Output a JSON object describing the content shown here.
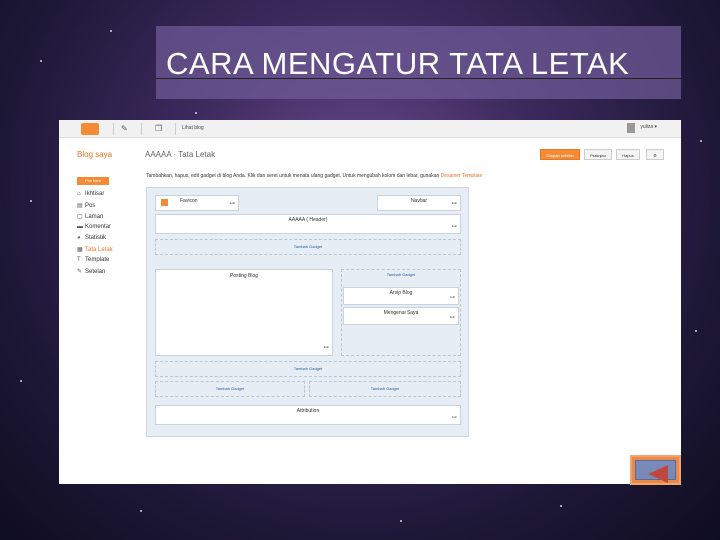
{
  "slide": {
    "title": "CARA MENGATUR TATA LETAK"
  },
  "blogger": {
    "toolbar": {
      "view_blog": "Lihat blog",
      "user": "yuliza ▾"
    },
    "blog_title": "Blog saya",
    "breadcrumb": "AAAAA · Tata Letak",
    "buttons": {
      "save": "Simpan setelan",
      "preview": "Pratinjau",
      "clear": "Hapus"
    },
    "sidebar": {
      "header": "Pos baru",
      "items": [
        {
          "icon": "⌂",
          "label": "Ikhtisar"
        },
        {
          "icon": "▤",
          "label": "Pos"
        },
        {
          "icon": "▢",
          "label": "Laman"
        },
        {
          "icon": "▬",
          "label": "Komentar"
        },
        {
          "icon": "◕",
          "label": "Statistik"
        },
        {
          "icon": "▦",
          "label": "Tata Letak"
        },
        {
          "icon": "T",
          "label": "Template"
        },
        {
          "icon": "✎",
          "label": "Setelan"
        }
      ]
    },
    "hint": "Tambahkan, hapus, edit gadget di blog Anda. Klik dan seret untuk menata ulang gadget. Untuk mengubah kolom dan lebar, gunakan",
    "hint_link": "Desainer Template",
    "layout": {
      "favicon": "Favicon",
      "navbar": "Navbar",
      "header": "AAAAA ( Header)",
      "add_gadget": "Tambah Gadget",
      "posts": "Posting Blog",
      "blog_archive": "Arsip Blog",
      "about_me": "Mengenai Saya",
      "attribution": "Attribution",
      "edit": "Edit"
    }
  }
}
